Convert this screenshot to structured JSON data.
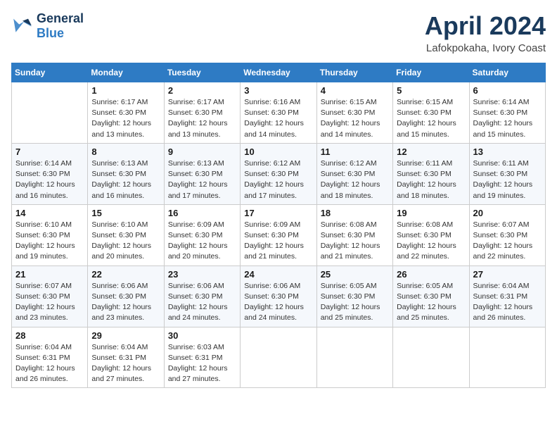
{
  "logo": {
    "line1": "General",
    "line2": "Blue"
  },
  "title": "April 2024",
  "subtitle": "Lafokpokaha, Ivory Coast",
  "days_of_week": [
    "Sunday",
    "Monday",
    "Tuesday",
    "Wednesday",
    "Thursday",
    "Friday",
    "Saturday"
  ],
  "weeks": [
    [
      {
        "num": "",
        "info": ""
      },
      {
        "num": "1",
        "info": "Sunrise: 6:17 AM\nSunset: 6:30 PM\nDaylight: 12 hours\nand 13 minutes."
      },
      {
        "num": "2",
        "info": "Sunrise: 6:17 AM\nSunset: 6:30 PM\nDaylight: 12 hours\nand 13 minutes."
      },
      {
        "num": "3",
        "info": "Sunrise: 6:16 AM\nSunset: 6:30 PM\nDaylight: 12 hours\nand 14 minutes."
      },
      {
        "num": "4",
        "info": "Sunrise: 6:15 AM\nSunset: 6:30 PM\nDaylight: 12 hours\nand 14 minutes."
      },
      {
        "num": "5",
        "info": "Sunrise: 6:15 AM\nSunset: 6:30 PM\nDaylight: 12 hours\nand 15 minutes."
      },
      {
        "num": "6",
        "info": "Sunrise: 6:14 AM\nSunset: 6:30 PM\nDaylight: 12 hours\nand 15 minutes."
      }
    ],
    [
      {
        "num": "7",
        "info": "Sunrise: 6:14 AM\nSunset: 6:30 PM\nDaylight: 12 hours\nand 16 minutes."
      },
      {
        "num": "8",
        "info": "Sunrise: 6:13 AM\nSunset: 6:30 PM\nDaylight: 12 hours\nand 16 minutes."
      },
      {
        "num": "9",
        "info": "Sunrise: 6:13 AM\nSunset: 6:30 PM\nDaylight: 12 hours\nand 17 minutes."
      },
      {
        "num": "10",
        "info": "Sunrise: 6:12 AM\nSunset: 6:30 PM\nDaylight: 12 hours\nand 17 minutes."
      },
      {
        "num": "11",
        "info": "Sunrise: 6:12 AM\nSunset: 6:30 PM\nDaylight: 12 hours\nand 18 minutes."
      },
      {
        "num": "12",
        "info": "Sunrise: 6:11 AM\nSunset: 6:30 PM\nDaylight: 12 hours\nand 18 minutes."
      },
      {
        "num": "13",
        "info": "Sunrise: 6:11 AM\nSunset: 6:30 PM\nDaylight: 12 hours\nand 19 minutes."
      }
    ],
    [
      {
        "num": "14",
        "info": "Sunrise: 6:10 AM\nSunset: 6:30 PM\nDaylight: 12 hours\nand 19 minutes."
      },
      {
        "num": "15",
        "info": "Sunrise: 6:10 AM\nSunset: 6:30 PM\nDaylight: 12 hours\nand 20 minutes."
      },
      {
        "num": "16",
        "info": "Sunrise: 6:09 AM\nSunset: 6:30 PM\nDaylight: 12 hours\nand 20 minutes."
      },
      {
        "num": "17",
        "info": "Sunrise: 6:09 AM\nSunset: 6:30 PM\nDaylight: 12 hours\nand 21 minutes."
      },
      {
        "num": "18",
        "info": "Sunrise: 6:08 AM\nSunset: 6:30 PM\nDaylight: 12 hours\nand 21 minutes."
      },
      {
        "num": "19",
        "info": "Sunrise: 6:08 AM\nSunset: 6:30 PM\nDaylight: 12 hours\nand 22 minutes."
      },
      {
        "num": "20",
        "info": "Sunrise: 6:07 AM\nSunset: 6:30 PM\nDaylight: 12 hours\nand 22 minutes."
      }
    ],
    [
      {
        "num": "21",
        "info": "Sunrise: 6:07 AM\nSunset: 6:30 PM\nDaylight: 12 hours\nand 23 minutes."
      },
      {
        "num": "22",
        "info": "Sunrise: 6:06 AM\nSunset: 6:30 PM\nDaylight: 12 hours\nand 23 minutes."
      },
      {
        "num": "23",
        "info": "Sunrise: 6:06 AM\nSunset: 6:30 PM\nDaylight: 12 hours\nand 24 minutes."
      },
      {
        "num": "24",
        "info": "Sunrise: 6:06 AM\nSunset: 6:30 PM\nDaylight: 12 hours\nand 24 minutes."
      },
      {
        "num": "25",
        "info": "Sunrise: 6:05 AM\nSunset: 6:30 PM\nDaylight: 12 hours\nand 25 minutes."
      },
      {
        "num": "26",
        "info": "Sunrise: 6:05 AM\nSunset: 6:30 PM\nDaylight: 12 hours\nand 25 minutes."
      },
      {
        "num": "27",
        "info": "Sunrise: 6:04 AM\nSunset: 6:31 PM\nDaylight: 12 hours\nand 26 minutes."
      }
    ],
    [
      {
        "num": "28",
        "info": "Sunrise: 6:04 AM\nSunset: 6:31 PM\nDaylight: 12 hours\nand 26 minutes."
      },
      {
        "num": "29",
        "info": "Sunrise: 6:04 AM\nSunset: 6:31 PM\nDaylight: 12 hours\nand 27 minutes."
      },
      {
        "num": "30",
        "info": "Sunrise: 6:03 AM\nSunset: 6:31 PM\nDaylight: 12 hours\nand 27 minutes."
      },
      {
        "num": "",
        "info": ""
      },
      {
        "num": "",
        "info": ""
      },
      {
        "num": "",
        "info": ""
      },
      {
        "num": "",
        "info": ""
      }
    ]
  ]
}
